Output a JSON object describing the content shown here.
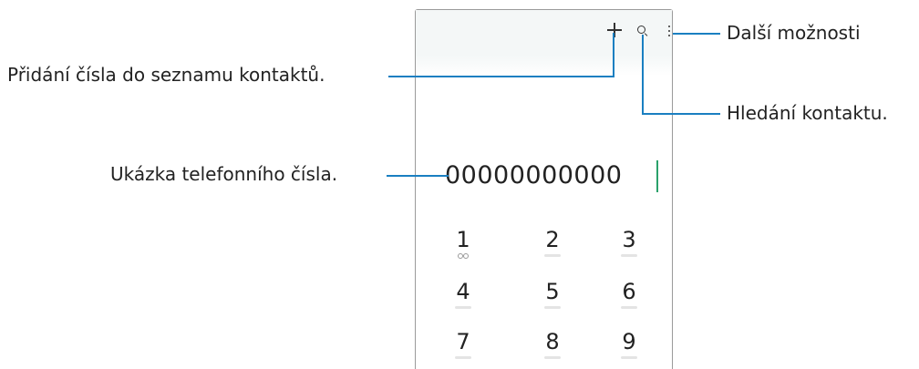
{
  "callouts": {
    "more_options": "Další možnosti",
    "add_contact": "Přidání čísla do seznamu kontaktů.",
    "search_contact": "Hledání kontaktu.",
    "number_preview": "Ukázka telefonního čísla."
  },
  "dialer": {
    "number": "00000000000",
    "header_icons": [
      "plus-icon",
      "search-icon",
      "more-vert-icon"
    ],
    "keys": [
      {
        "digit": "1",
        "sub": "voicemail-icon"
      },
      {
        "digit": "2"
      },
      {
        "digit": "3"
      },
      {
        "digit": "4"
      },
      {
        "digit": "5"
      },
      {
        "digit": "6"
      },
      {
        "digit": "7"
      },
      {
        "digit": "8"
      },
      {
        "digit": "9"
      }
    ]
  },
  "colors": {
    "leader_line": "#1a7fc1",
    "caret": "#2aa16b",
    "header_bg": "#f4f7f7"
  }
}
